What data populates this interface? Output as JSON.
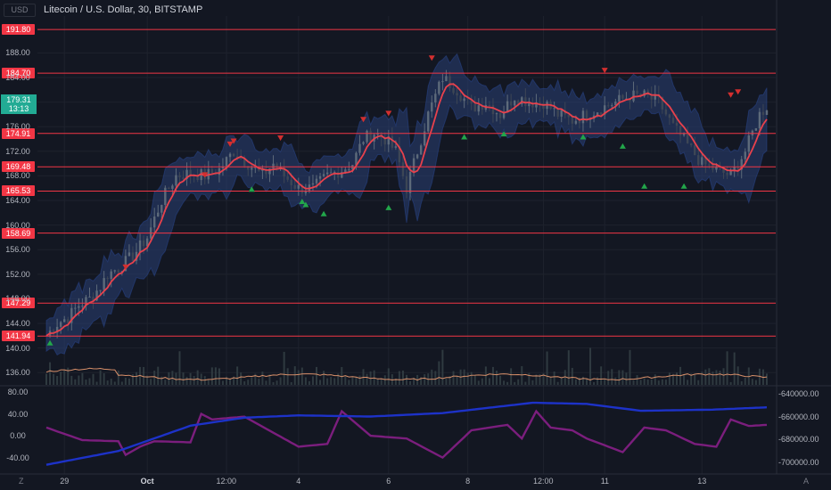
{
  "header": {
    "currency": "USD",
    "title": "Litecoin / U.S. Dollar, 30, BITSTAMP"
  },
  "last_price": {
    "value": "179.31",
    "countdown": "13:13"
  },
  "left_axis_main_ticks": [
    "188.00",
    "184.00",
    "180.00",
    "176.00",
    "172.00",
    "168.00",
    "164.00",
    "160.00",
    "156.00",
    "152.00",
    "148.00",
    "144.00",
    "140.00",
    "136.00"
  ],
  "left_axis_osc_ticks": [
    "80.00",
    "40.00",
    "0.00",
    "-40.00"
  ],
  "right_axis_ticks": [
    "-640000.00",
    "-660000.00",
    "-680000.00",
    "-700000.00"
  ],
  "x_axis_labels": [
    "29",
    "Oct",
    "12:00",
    "4",
    "6",
    "8",
    "12:00",
    "11",
    "13"
  ],
  "corner_buttons": {
    "left": "Z",
    "right": "A"
  },
  "colors": {
    "background": "#131722",
    "candle_up": "#5d6a7a",
    "candle_down": "#3d4655",
    "ma": "#e8414c",
    "band": "#2a3f75",
    "level_line": "#f23645",
    "sell_arrow": "#d32f2f",
    "buy_arrow": "#22a64a",
    "volume_ma": "#d9906a",
    "osc_line": "#7b1e7d",
    "obv_line": "#1d32c8"
  },
  "chart_data": [
    {
      "type": "candlestick",
      "title": "Litecoin / U.S. Dollar, 30, BITSTAMP",
      "xlabel": "",
      "ylabel": "",
      "ylim": [
        134,
        194
      ],
      "x_ticks": [
        "29",
        "Oct",
        "12:00",
        "4",
        "6",
        "8",
        "12:00",
        "11",
        "13"
      ],
      "close_path": {
        "x": [
          0,
          3,
          6,
          9,
          12,
          15,
          17,
          20,
          24,
          28,
          32,
          36,
          40,
          44,
          48,
          52,
          56,
          60,
          63,
          66,
          70,
          74,
          78,
          82,
          85,
          88,
          91,
          94,
          97,
          100,
          103,
          106,
          110,
          114,
          118,
          122,
          126,
          130,
          134,
          138,
          142,
          146,
          150,
          154,
          158,
          162,
          166,
          170,
          174,
          178,
          182,
          186,
          190,
          194,
          198,
          200
        ],
        "y": [
          142,
          144,
          145,
          147,
          148,
          150,
          152,
          153,
          155,
          158,
          164,
          168,
          168.5,
          168,
          169,
          172,
          170,
          168,
          170,
          168,
          166,
          166,
          168,
          169,
          170,
          174,
          175,
          174,
          172,
          166,
          172,
          178,
          184,
          182,
          179,
          180,
          178,
          181,
          180,
          180,
          178,
          177,
          178,
          179,
          180,
          181,
          181,
          180,
          176,
          173,
          170,
          169,
          168,
          172,
          178,
          179.3
        ]
      },
      "horizontal_levels": [
        191.8,
        184.7,
        174.91,
        169.48,
        165.53,
        158.69,
        147.29,
        141.94
      ],
      "sell_signals": [
        {
          "x": 22,
          "y": 153
        },
        {
          "x": 44,
          "y": 168
        },
        {
          "x": 51,
          "y": 173
        },
        {
          "x": 52,
          "y": 173.5
        },
        {
          "x": 65,
          "y": 174
        },
        {
          "x": 88,
          "y": 177
        },
        {
          "x": 95,
          "y": 178
        },
        {
          "x": 107,
          "y": 187
        },
        {
          "x": 155,
          "y": 185
        },
        {
          "x": 190,
          "y": 181
        },
        {
          "x": 192,
          "y": 181.5
        }
      ],
      "buy_signals": [
        {
          "x": 1,
          "y": 141
        },
        {
          "x": 57,
          "y": 166
        },
        {
          "x": 71,
          "y": 164
        },
        {
          "x": 72,
          "y": 163.5
        },
        {
          "x": 77,
          "y": 162
        },
        {
          "x": 95,
          "y": 163
        },
        {
          "x": 116,
          "y": 174.5
        },
        {
          "x": 127,
          "y": 175
        },
        {
          "x": 149,
          "y": 174.5
        },
        {
          "x": 160,
          "y": 173
        },
        {
          "x": 166,
          "y": 166.5
        },
        {
          "x": 177,
          "y": 166.5
        }
      ]
    },
    {
      "type": "line",
      "series": [
        {
          "x": [
            0,
            10,
            20,
            22,
            26,
            30,
            40,
            43,
            46,
            55,
            70,
            78,
            82,
            90,
            100,
            110,
            118,
            128,
            132,
            136,
            140,
            146,
            150,
            160,
            166,
            172,
            180,
            186,
            190,
            195,
            200
          ],
          "y": [
            15,
            -8,
            -10,
            -35,
            -20,
            -10,
            -12,
            40,
            30,
            35,
            -20,
            -15,
            45,
            0,
            -5,
            -40,
            10,
            20,
            -5,
            45,
            15,
            10,
            -5,
            -30,
            15,
            10,
            -15,
            -20,
            30,
            18,
            20
          ]
        },
        {
          "x": [
            0,
            20,
            40,
            55,
            70,
            90,
            110,
            135,
            150,
            165,
            185,
            200
          ],
          "y": [
            -702000,
            -690000,
            -668000,
            -661000,
            -659000,
            -660000,
            -657000,
            -648000,
            -649000,
            -655000,
            -654000,
            -652000
          ]
        }
      ],
      "ylim": [
        -70,
        90
      ]
    }
  ]
}
